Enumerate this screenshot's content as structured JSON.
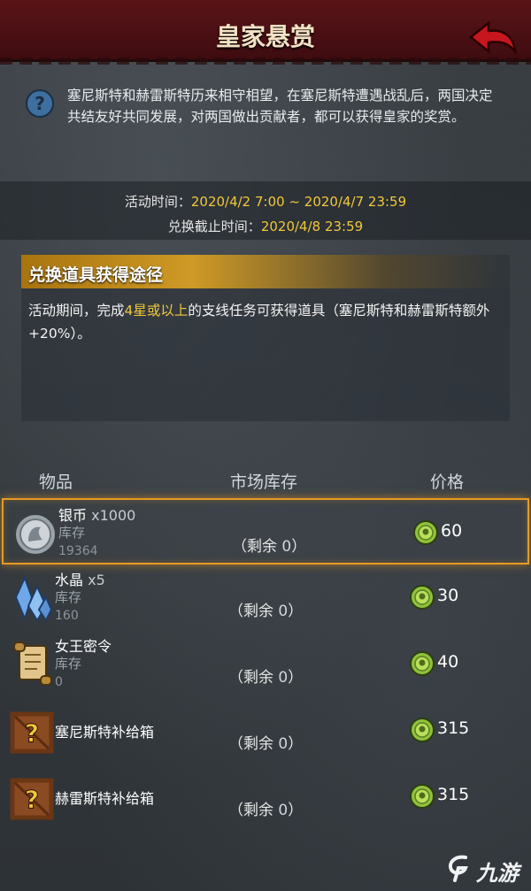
{
  "header": {
    "title": "皇家悬赏"
  },
  "description": "塞尼斯特和赫雷斯特历来相守相望，在塞尼斯特遭遇战乱后，两国决定共结友好共同发展，对两国做出贡献者，都可以获得皇家的奖赏。",
  "times": {
    "event_label": "活动时间：",
    "event_value": "2020/4/2 7:00 ~ 2020/4/7 23:59",
    "exchange_label": "兑换截止时间：",
    "exchange_value": "2020/4/8 23:59"
  },
  "panel": {
    "title": "兑换道具获得途径",
    "text_a": "活动期间，完成",
    "text_highlight": "4星或以上",
    "text_b": "的支线任务可获得道具（塞尼斯特和赫雷斯特额外+20%）。"
  },
  "columns": {
    "item": "物品",
    "market": "市场库存",
    "price": "价格"
  },
  "items": [
    {
      "name": "银币",
      "qty": "x1000",
      "stock_label": "库存",
      "stock": "19364",
      "remain_label": "（剩余",
      "remain": "0",
      "remain_end": "）",
      "price": "60",
      "icon": "silver-coin-icon",
      "selected": true
    },
    {
      "name": "水晶",
      "qty": "x5",
      "stock_label": "库存",
      "stock": "160",
      "remain_label": "（剩余",
      "remain": "0",
      "remain_end": "）",
      "price": "30",
      "icon": "crystal-icon"
    },
    {
      "name": "女王密令",
      "qty": "",
      "stock_label": "库存",
      "stock": "0",
      "remain_label": "（剩余",
      "remain": "0",
      "remain_end": "）",
      "price": "40",
      "icon": "scroll-icon"
    },
    {
      "name": "塞尼斯特补给箱",
      "qty": "",
      "stock_label": "",
      "stock": "",
      "remain_label": "（剩余",
      "remain": "0",
      "remain_end": "）",
      "price": "315",
      "icon": "mystery-crate-icon"
    },
    {
      "name": "赫雷斯特补给箱",
      "qty": "",
      "stock_label": "",
      "stock": "",
      "remain_label": "（剩余",
      "remain": "0",
      "remain_end": "）",
      "price": "315",
      "icon": "mystery-crate-icon"
    }
  ],
  "watermark": {
    "text": "九游"
  },
  "colors": {
    "accent_gold": "#f2c73a",
    "title_bar": "#4a1014",
    "selection_border": "#e69a22",
    "currency_green": "#8fc23a"
  }
}
